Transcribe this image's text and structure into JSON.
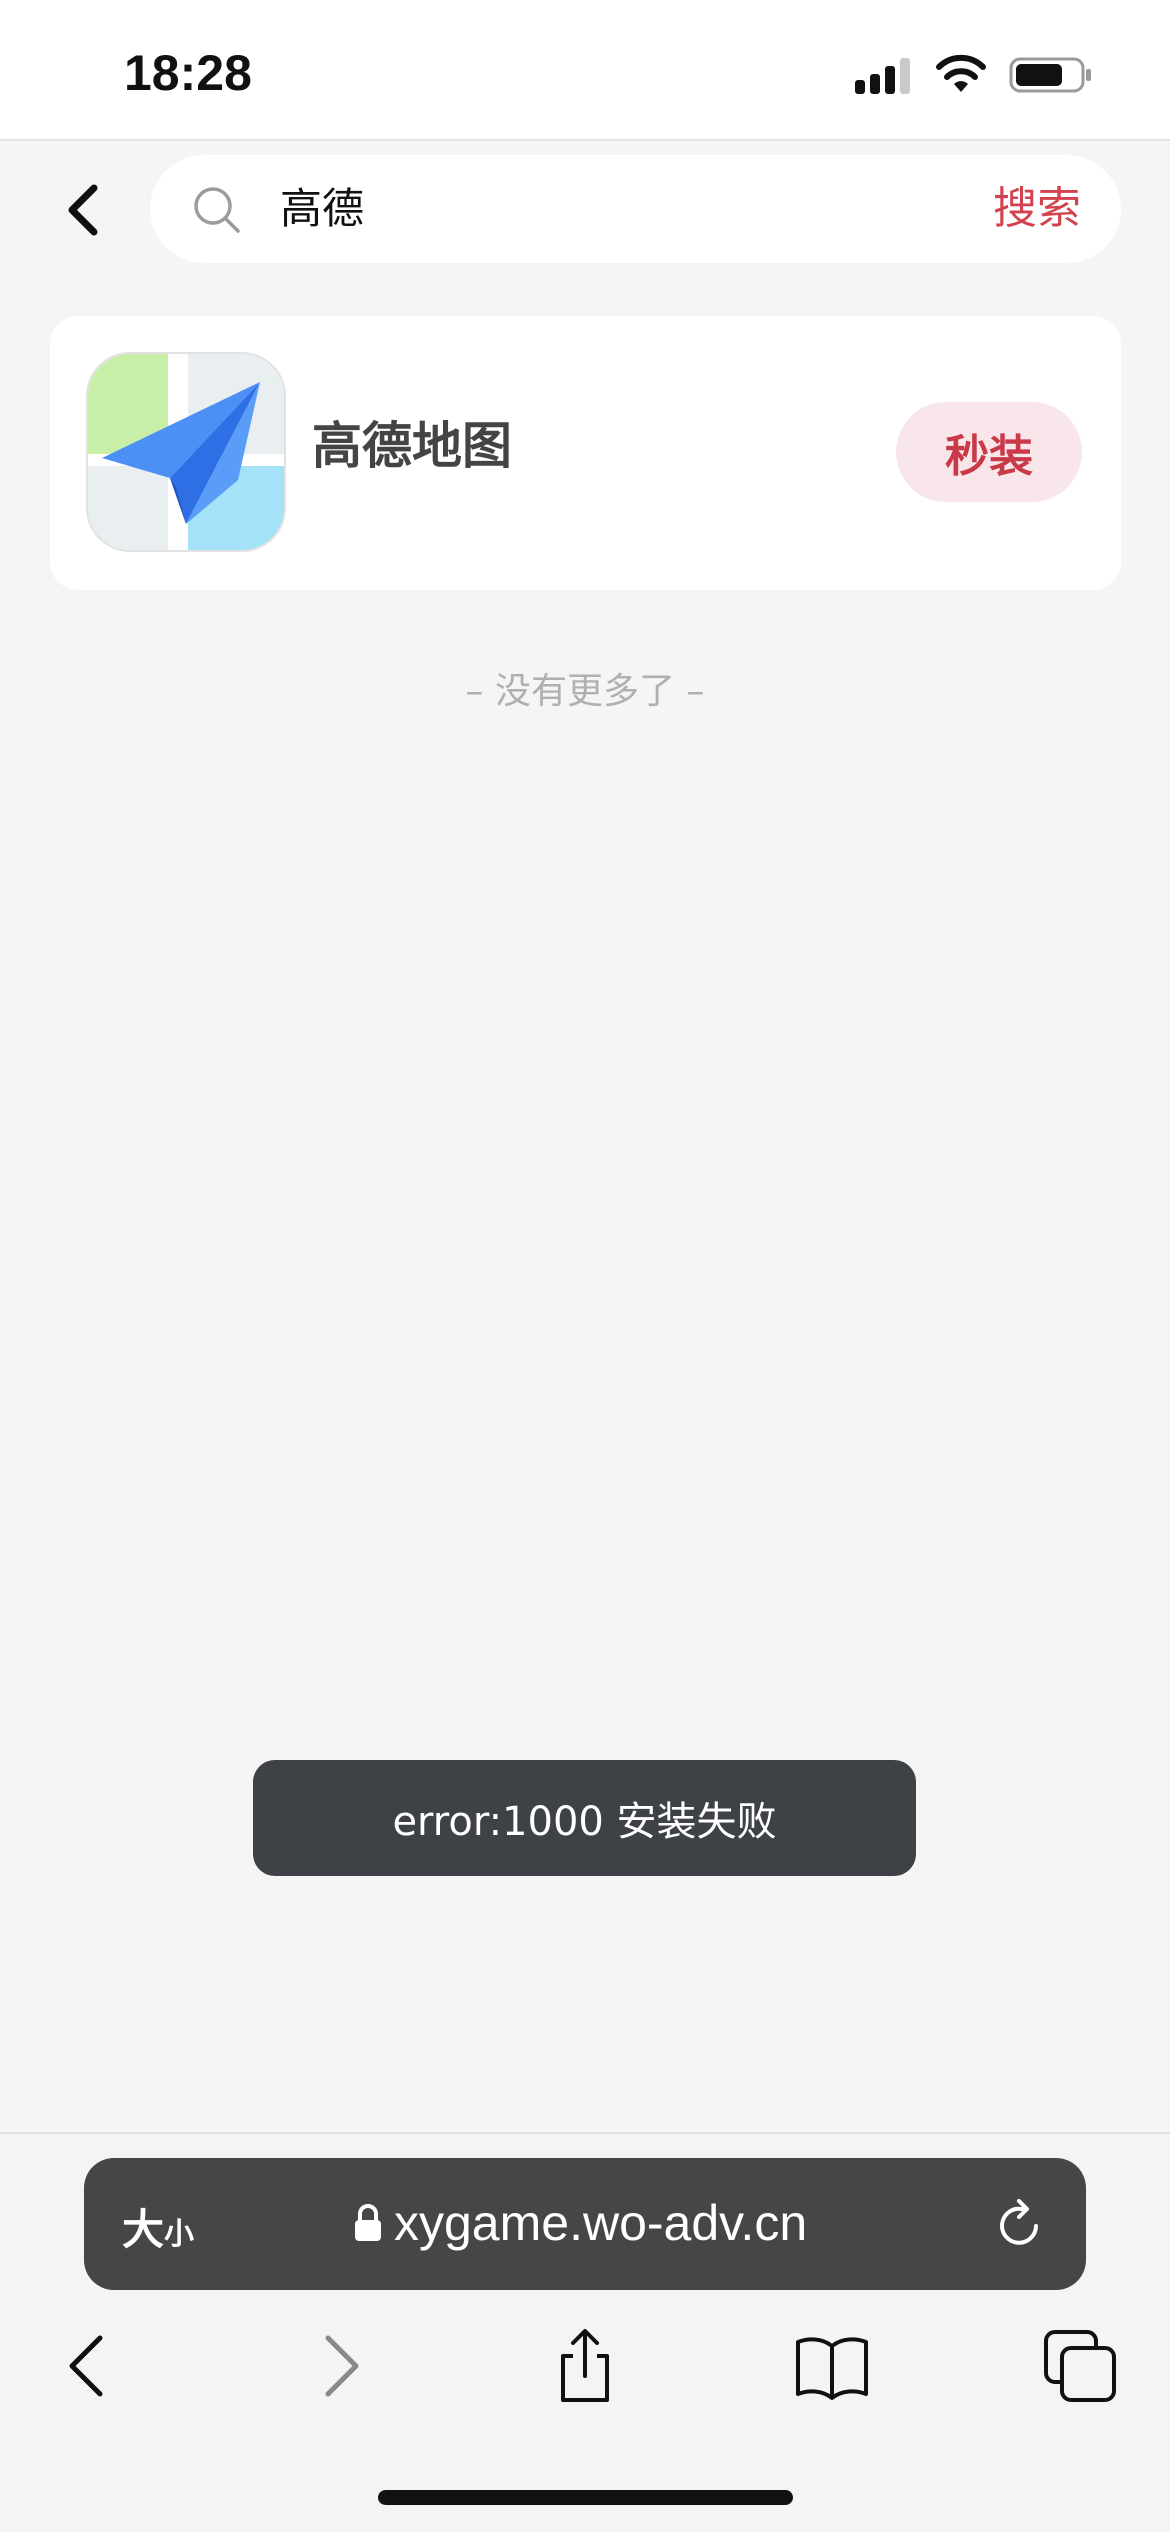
{
  "status_bar": {
    "time": "18:28",
    "icons": [
      "cellular-signal-icon",
      "wifi-icon",
      "battery-icon"
    ]
  },
  "search": {
    "back_icon": "chevron-left-icon",
    "search_icon": "magnifier-icon",
    "query": "高德",
    "button_label": "搜索",
    "accent_color": "#d2434f"
  },
  "results": [
    {
      "icon": "gaode-map-app-icon",
      "name": "高德地图",
      "action_label": "秒装"
    }
  ],
  "list_end_text": "– 没有更多了 –",
  "toast": {
    "message": "error:1000 安装失败"
  },
  "browser": {
    "text_size_label_big": "大",
    "text_size_label_small": "小",
    "url": "xygame.wo-adv.cn",
    "icons": [
      "lock-icon",
      "reload-icon",
      "back-icon",
      "forward-icon",
      "share-icon",
      "bookmarks-icon",
      "tabs-icon"
    ]
  }
}
